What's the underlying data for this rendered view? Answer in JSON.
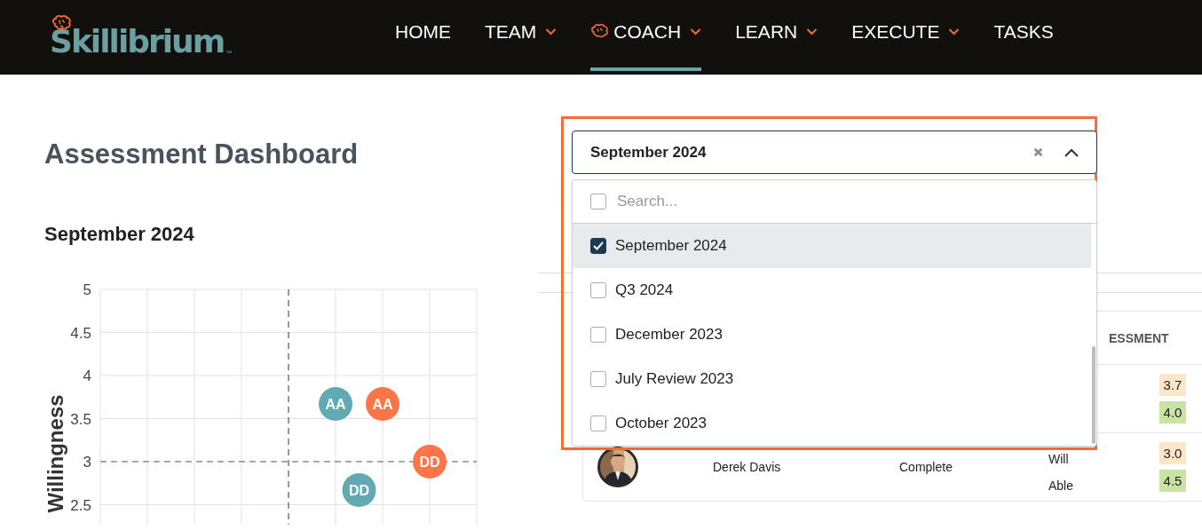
{
  "brand": {
    "name": "Skillibrium",
    "mark": "™"
  },
  "nav": [
    {
      "label": "HOME",
      "has_menu": false,
      "has_icon": false,
      "selected": false
    },
    {
      "label": "TEAM",
      "has_menu": true,
      "has_icon": false,
      "selected": false
    },
    {
      "label": "COACH",
      "has_menu": true,
      "has_icon": true,
      "selected": true
    },
    {
      "label": "LEARN",
      "has_menu": true,
      "has_icon": false,
      "selected": false
    },
    {
      "label": "EXECUTE",
      "has_menu": true,
      "has_icon": false,
      "selected": false
    },
    {
      "label": "TASKS",
      "has_menu": false,
      "has_icon": false,
      "selected": false
    }
  ],
  "page_title": "Assessment Dashboard",
  "chart_title": "September 2024",
  "chart": {
    "ylabel": "Willingness",
    "yticks": [
      "5",
      "4.5",
      "4",
      "3.5",
      "3",
      "2.5"
    ],
    "points": [
      {
        "label": "AA",
        "color": "#62aab3"
      },
      {
        "label": "AA",
        "color": "#ff7448"
      },
      {
        "label": "DD",
        "color": "#ff7448"
      },
      {
        "label": "DD",
        "color": "#62aab3"
      }
    ]
  },
  "table": {
    "header": "ESSMENT",
    "rows": [
      {
        "scores": [
          {
            "value": "3.7",
            "color": "#fde5c8"
          },
          {
            "value": "4.0",
            "color": "#c8e3a4"
          }
        ]
      },
      {
        "name": "Derek Davis",
        "status": "Complete",
        "labels": [
          "Will",
          "Able"
        ],
        "scores": [
          {
            "value": "3.0",
            "color": "#fde5c8"
          },
          {
            "value": "4.5",
            "color": "#c8e3a4"
          }
        ]
      }
    ]
  },
  "period_select": {
    "value": "September 2024",
    "expanded": true,
    "highlighted": true,
    "search": {
      "placeholder": "Search...",
      "checked": false
    },
    "options": [
      {
        "label": "September 2024",
        "checked": true,
        "selected": true
      },
      {
        "label": "Q3 2024",
        "checked": false,
        "selected": false
      },
      {
        "label": "December 2023",
        "checked": false,
        "selected": false
      },
      {
        "label": "July Review 2023",
        "checked": false,
        "selected": false
      },
      {
        "label": "October 2023",
        "checked": false,
        "selected": false
      }
    ]
  }
}
